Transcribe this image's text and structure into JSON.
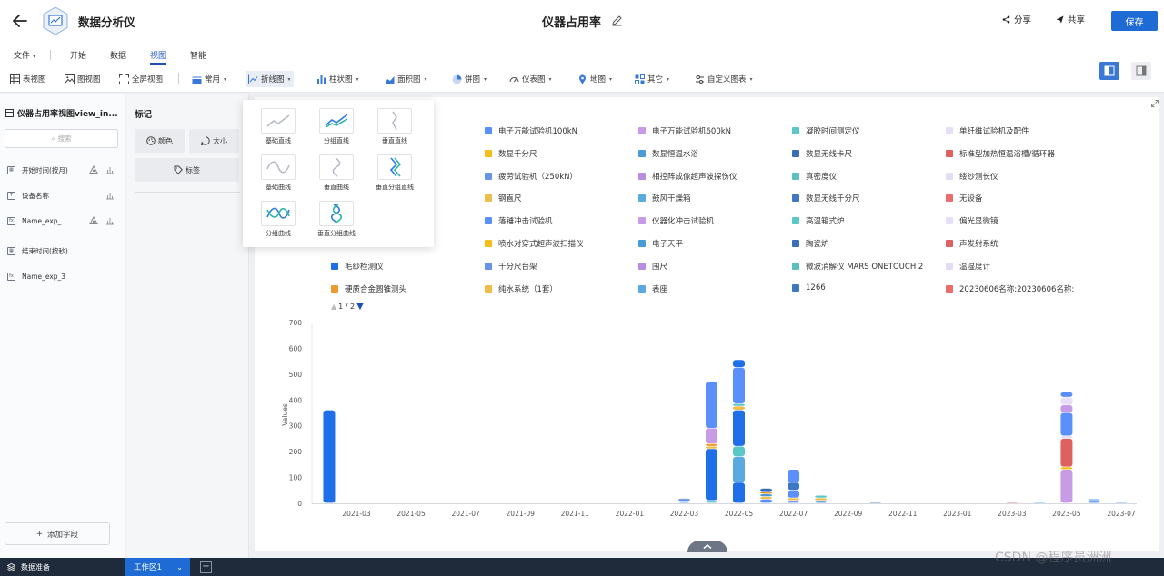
{
  "header": {
    "app_name": "数据分析仪",
    "doc_title": "仪器占用率",
    "share_label": "分享",
    "export_label": "共享",
    "save_label": "保存"
  },
  "menu": {
    "items": [
      "文件",
      "开始",
      "数据",
      "视图",
      "智能"
    ],
    "active": "视图"
  },
  "toolbar": {
    "items": [
      {
        "label": "表视图",
        "icon": "table-icon"
      },
      {
        "label": "图视图",
        "icon": "image-icon"
      },
      {
        "label": "全屏视图",
        "icon": "fullscreen-icon"
      },
      {
        "label": "常用",
        "icon": "common-chart-icon"
      },
      {
        "label": "折线图",
        "icon": "line-chart-icon"
      },
      {
        "label": "柱状图",
        "icon": "bar-chart-icon"
      },
      {
        "label": "面积图",
        "icon": "area-chart-icon"
      },
      {
        "label": "饼图",
        "icon": "pie-chart-icon"
      },
      {
        "label": "仪表图",
        "icon": "gauge-chart-icon"
      },
      {
        "label": "地图",
        "icon": "map-icon"
      },
      {
        "label": "其它",
        "icon": "other-chart-icon"
      },
      {
        "label": "自定义图表",
        "icon": "custom-chart-icon"
      }
    ]
  },
  "left_panel": {
    "title": "仪器占用率视图view_in...",
    "search_placeholder": "搜索",
    "fields": [
      {
        "label": "开始时间(按月)",
        "type": "date"
      },
      {
        "label": "设备名称",
        "type": "text"
      },
      {
        "label": "Name_exp_...",
        "type": "expr"
      },
      {
        "label": "结束时间(按秒)",
        "type": "date"
      },
      {
        "label": "Name_exp_3",
        "type": "expr"
      }
    ],
    "add_field_label": "添加字段"
  },
  "marks_panel": {
    "title": "标记",
    "color_label": "颜色",
    "size_label": "大小",
    "tag_label": "标签"
  },
  "line_dropdown": {
    "options": [
      "基础直线",
      "分组直线",
      "垂直直线",
      "基础曲线",
      "垂直曲线",
      "垂直分组直线",
      "分组曲线",
      "垂直分组曲线"
    ]
  },
  "legend": {
    "items": [
      {
        "label": "电子万能试验机100kN",
        "color": "#5b8ff9"
      },
      {
        "label": "电子万能试验机600kN",
        "color": "#c79be8"
      },
      {
        "label": "凝胶时间测定仪",
        "color": "#5ac8c8"
      },
      {
        "label": "单纤维试验机及配件",
        "color": "#e8def8"
      },
      {
        "label": "数显千分尺",
        "color": "#f6bd16"
      },
      {
        "label": "数显恒温水浴",
        "color": "#4b9cd6"
      },
      {
        "label": "数显无线卡尺",
        "color": "#3a6fb8"
      },
      {
        "label": "标准型加热恒温浴槽/循环器",
        "color": "#e06060"
      },
      {
        "label": "疲劳试验机（250kN）",
        "color": "#6794e8"
      },
      {
        "label": "相控阵成像超声波探伤仪",
        "color": "#b98de0"
      },
      {
        "label": "真密度仪",
        "color": "#5abfbf"
      },
      {
        "label": "缕纱测长仪",
        "color": "#e4dcf4"
      },
      {
        "label": "钢直尺",
        "color": "#f0bd4c"
      },
      {
        "label": "鼓风干燥箱",
        "color": "#5aa9e0"
      },
      {
        "label": "数显无线千分尺",
        "color": "#3e78c2"
      },
      {
        "label": "无设备",
        "color": "#ec6b6b"
      },
      {
        "label": "落锤冲击试验机",
        "color": "#5b8ff9"
      },
      {
        "label": "仪器化冲击试验机",
        "color": "#c79be8"
      },
      {
        "label": "高温箱式炉",
        "color": "#5ac8c8"
      },
      {
        "label": "偏光显微镜",
        "color": "#e8def8"
      },
      {
        "label": "喷水对穿式超声波扫描仪",
        "color": "#f6bd16"
      },
      {
        "label": "电子天平",
        "color": "#4b9cd6"
      },
      {
        "label": "陶瓷炉",
        "color": "#3a6fb8"
      },
      {
        "label": "声发射系统",
        "color": "#e06060"
      },
      {
        "label": "毛纱检测仪",
        "color": "#1e6fe8"
      },
      {
        "label": "千分尺台架",
        "color": "#6794e8"
      },
      {
        "label": "围尺",
        "color": "#b98de0"
      },
      {
        "label": "微波消解仪 MARS ONETOUCH 2",
        "color": "#5abfbf"
      },
      {
        "label": "温湿度计",
        "color": "#e4dcf4"
      },
      {
        "label": "硬质合金圆锥测头",
        "color": "#ee9a2e"
      },
      {
        "label": "纯水系统（1套）",
        "color": "#f0bd4c"
      },
      {
        "label": "表座",
        "color": "#5aa9e0"
      },
      {
        "label": "1266",
        "color": "#3e78c2"
      },
      {
        "label": "20230606名称:20230606名称:",
        "color": "#ec6b6b"
      }
    ],
    "pager": "1 / 2"
  },
  "chart_data": {
    "type": "bar",
    "stacked": true,
    "ylabel": "Values",
    "ylim": [
      0,
      700
    ],
    "yticks": [
      0,
      100,
      200,
      300,
      400,
      500,
      600,
      700
    ],
    "x_tick_labels": [
      "2021-03",
      "2021-05",
      "2021-07",
      "2021-09",
      "2021-11",
      "2022-01",
      "2022-03",
      "2022-05",
      "2022-07",
      "2022-09",
      "2022-11",
      "2023-01",
      "2023-03",
      "2023-05",
      "2023-07"
    ],
    "categories": [
      "2021-02",
      "2022-03",
      "2022-04",
      "2022-05",
      "2022-06",
      "2022-07",
      "2022-08",
      "2022-10",
      "2023-03",
      "2023-04",
      "2023-05",
      "2023-06",
      "2023-07"
    ],
    "bars": [
      {
        "category": "2021-02",
        "segments": [
          {
            "value": 360,
            "color": "#1e6fe8"
          }
        ]
      },
      {
        "category": "2022-03",
        "segments": [
          {
            "value": 8,
            "color": "#4b9cd6"
          },
          {
            "value": 6,
            "color": "#5b8ff9"
          },
          {
            "value": 4,
            "color": "#3a6fb8"
          }
        ]
      },
      {
        "category": "2022-04",
        "segments": [
          {
            "value": 10,
            "color": "#5ac8c8"
          },
          {
            "value": 200,
            "color": "#1e6fe8"
          },
          {
            "value": 10,
            "color": "#f0bd4c"
          },
          {
            "value": 10,
            "color": "#ee9a2e"
          },
          {
            "value": 60,
            "color": "#c79be8"
          },
          {
            "value": 180,
            "color": "#5b8ff9"
          }
        ]
      },
      {
        "category": "2022-05",
        "segments": [
          {
            "value": 80,
            "color": "#1e6fe8"
          },
          {
            "value": 100,
            "color": "#5aa9e0"
          },
          {
            "value": 40,
            "color": "#5ac8c8"
          },
          {
            "value": 140,
            "color": "#1e6fe8"
          },
          {
            "value": 15,
            "color": "#f0bd4c"
          },
          {
            "value": 10,
            "color": "#5ac8c8"
          },
          {
            "value": 140,
            "color": "#5b8ff9"
          },
          {
            "value": 30,
            "color": "#1e6fe8"
          }
        ]
      },
      {
        "category": "2022-06",
        "segments": [
          {
            "value": 15,
            "color": "#5b8ff9"
          },
          {
            "value": 10,
            "color": "#f0bd4c"
          },
          {
            "value": 10,
            "color": "#4b9cd6"
          },
          {
            "value": 10,
            "color": "#ee9a2e"
          },
          {
            "value": 12,
            "color": "#3a6fb8"
          }
        ]
      },
      {
        "category": "2022-07",
        "segments": [
          {
            "value": 10,
            "color": "#5b8ff9"
          },
          {
            "value": 10,
            "color": "#f0bd4c"
          },
          {
            "value": 30,
            "color": "#5b8ff9"
          },
          {
            "value": 30,
            "color": "#3e78c2"
          },
          {
            "value": 50,
            "color": "#5b8ff9"
          }
        ]
      },
      {
        "category": "2022-08",
        "segments": [
          {
            "value": 10,
            "color": "#4b9cd6"
          },
          {
            "value": 10,
            "color": "#f0bd4c"
          },
          {
            "value": 10,
            "color": "#5ac8c8"
          }
        ]
      },
      {
        "category": "2022-10",
        "segments": [
          {
            "value": 6,
            "color": "#3a6fb8"
          }
        ]
      },
      {
        "category": "2023-03",
        "segments": [
          {
            "value": 7,
            "color": "#e06060"
          }
        ]
      },
      {
        "category": "2023-04",
        "segments": [
          {
            "value": 5,
            "color": "#5b8ff9"
          }
        ]
      },
      {
        "category": "2023-05",
        "segments": [
          {
            "value": 130,
            "color": "#c79be8"
          },
          {
            "value": 10,
            "color": "#f6bd16"
          },
          {
            "value": 110,
            "color": "#e06060"
          },
          {
            "value": 10,
            "color": "#e4dcf4"
          },
          {
            "value": 90,
            "color": "#5b8ff9"
          },
          {
            "value": 30,
            "color": "#c79be8"
          },
          {
            "value": 30,
            "color": "#e8def8"
          },
          {
            "value": 20,
            "color": "#5b8ff9"
          }
        ]
      },
      {
        "category": "2023-06",
        "segments": [
          {
            "value": 10,
            "color": "#5b8ff9"
          },
          {
            "value": 6,
            "color": "#4b9cd6"
          }
        ]
      },
      {
        "category": "2023-07",
        "segments": [
          {
            "value": 6,
            "color": "#5b8ff9"
          }
        ]
      }
    ]
  },
  "bottom_bar": {
    "prep_label": "数据准备",
    "tab_label": "工作区1"
  },
  "watermark": "CSDN @程序员洲洲"
}
